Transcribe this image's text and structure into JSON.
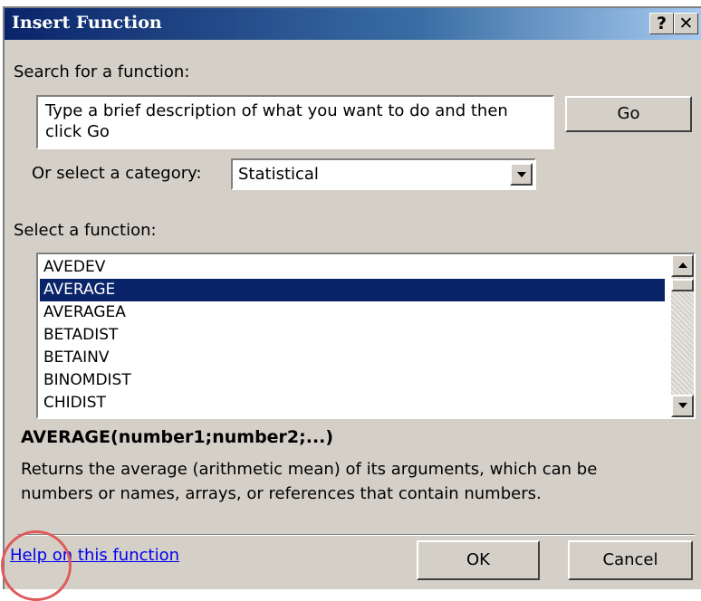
{
  "window": {
    "title": "Insert Function",
    "help_btn": "?",
    "close_btn": "✕"
  },
  "search": {
    "label": "Search for a function:",
    "value": "Type a brief description of what you want to do and then click Go",
    "go_label": "Go"
  },
  "category": {
    "label": "Or select a category:",
    "value": "Statistical"
  },
  "functions": {
    "label": "Select a function:",
    "items": [
      "AVEDEV",
      "AVERAGE",
      "AVERAGEA",
      "BETADIST",
      "BETAINV",
      "BINOMDIST",
      "CHIDIST"
    ],
    "selected": "AVERAGE"
  },
  "details": {
    "signature": "AVERAGE(number1;number2;...)",
    "description": "Returns the average (arithmetic mean) of its arguments, which can be numbers or names, arrays, or references that contain numbers."
  },
  "footer": {
    "help_link": "Help on this function",
    "ok_label": "OK",
    "cancel_label": "Cancel"
  },
  "colors": {
    "selection": "#0a246a",
    "link": "#0000ee",
    "highlight_circle": "#e05a5a"
  }
}
